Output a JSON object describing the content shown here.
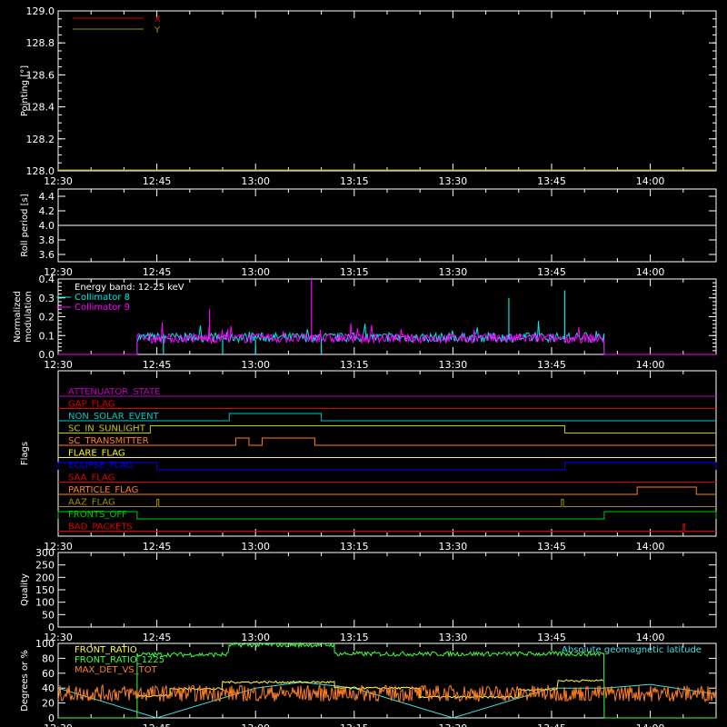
{
  "chart_data": [
    {
      "type": "line",
      "panel": "pointing",
      "ylabel": "Pointing [°]",
      "ylim": [
        128.0,
        129.0
      ],
      "yticks": [
        "128.0",
        "128.2",
        "128.4",
        "128.6",
        "128.8",
        "129.0"
      ],
      "xticks": [
        "12:30",
        "12:45",
        "13:00",
        "13:15",
        "13:30",
        "13:45",
        "14:00"
      ],
      "xlim": [
        "12:30",
        "14:10"
      ],
      "legend": "top-left",
      "series": [
        {
          "name": "X",
          "color": "#e00000",
          "values": []
        },
        {
          "name": "Y",
          "color": "#a09000",
          "values": []
        }
      ]
    },
    {
      "type": "line",
      "panel": "roll-period",
      "ylabel": "Roll period [s]",
      "ylim": [
        3.5,
        4.5
      ],
      "yticks": [
        "3.6",
        "3.8",
        "4.0",
        "4.2",
        "4.4"
      ],
      "xticks": [
        "12:30",
        "12:45",
        "13:00",
        "13:15",
        "13:30",
        "13:45",
        "14:00"
      ],
      "series": [
        {
          "color": "#ffffff",
          "x": [
            "12:30",
            "14:10"
          ],
          "values": [
            4.0,
            4.0
          ]
        }
      ]
    },
    {
      "type": "line",
      "panel": "modulation",
      "ylabel": "Normalized modulation",
      "ylim": [
        0.0,
        0.4
      ],
      "yticks": [
        "0.0",
        "0.1",
        "0.2",
        "0.3",
        "0.4"
      ],
      "xticks": [
        "12:30",
        "12:45",
        "13:00",
        "13:15",
        "13:30",
        "13:45",
        "14:00"
      ],
      "annotation": "Energy band: 12-25 keV",
      "legend": "top-left",
      "series": [
        {
          "name": "Collimator 8",
          "color": "#00e8e8",
          "x_start": "12:42",
          "x_end": "13:53",
          "baseline": 0.09
        },
        {
          "name": "Collimator 9",
          "color": "#ff00ff",
          "x_start": "12:42",
          "x_end": "13:53",
          "baseline": 0.085
        }
      ],
      "spikes": [
        {
          "series": "Collimator 9",
          "t": "13:08.5",
          "v": 0.4
        },
        {
          "series": "Collimator 8",
          "t": "13:38.5",
          "v": 0.3
        },
        {
          "series": "Collimator 8",
          "t": "13:47",
          "v": 0.34
        },
        {
          "series": "Collimator 9",
          "t": "12:53",
          "v": 0.24
        }
      ]
    },
    {
      "type": "line",
      "panel": "flags",
      "ylabel": "Flags",
      "xticks": [
        "12:30",
        "12:45",
        "13:00",
        "13:15",
        "13:30",
        "13:45",
        "14:00"
      ],
      "flags": [
        {
          "name": "ATTENUATOR_STATE",
          "color": "#c000c0",
          "steps": []
        },
        {
          "name": "GAP_FLAG",
          "color": "#e00000",
          "steps": []
        },
        {
          "name": "NON_SOLAR_EVENT",
          "color": "#00c8c8",
          "steps": [
            [
              "12:56",
              "13:10"
            ]
          ]
        },
        {
          "name": "SC_IN_SUNLIGHT",
          "color": "#c8c800",
          "steps": [
            [
              "12:44",
              "13:47"
            ]
          ]
        },
        {
          "name": "SC_TRANSMITTER",
          "color": "#ff8020",
          "steps": [
            [
              "12:57",
              "12:59"
            ],
            [
              "13:01",
              "13:09"
            ]
          ]
        },
        {
          "name": "FLARE_FLAG",
          "color": "#ffff00",
          "steps": []
        },
        {
          "name": "ECLIPSE_FLAG",
          "color": "#0000ff",
          "steps": [
            [
              "12:30",
              "12:45"
            ],
            [
              "13:47",
              "14:10"
            ]
          ]
        },
        {
          "name": "SAA_FLAG",
          "color": "#e00000",
          "steps": []
        },
        {
          "name": "PARTICLE_FLAG",
          "color": "#ff8020",
          "steps": [
            [
              "13:58",
              "14:07"
            ]
          ]
        },
        {
          "name": "AAZ_FLAG",
          "color": "#a09000",
          "steps": [
            [
              "12:45",
              "12:45.3"
            ],
            [
              "13:46.5",
              "13:46.8"
            ]
          ]
        },
        {
          "name": "FRONTS_OFF",
          "color": "#00d000",
          "steps": [
            [
              "12:30",
              "12:42"
            ],
            [
              "13:53",
              "14:10"
            ]
          ]
        },
        {
          "name": "BAD_PACKETS",
          "color": "#e00000",
          "steps": [
            [
              "14:05",
              "14:05.2"
            ]
          ]
        }
      ]
    },
    {
      "type": "line",
      "panel": "quality",
      "ylabel": "Quality",
      "ylim": [
        0,
        300
      ],
      "yticks": [
        "0",
        "50",
        "100",
        "150",
        "200",
        "250",
        "300"
      ],
      "xticks": [
        "12:30",
        "12:45",
        "13:00",
        "13:15",
        "13:30",
        "13:45",
        "14:00"
      ],
      "series": []
    },
    {
      "type": "line",
      "panel": "ratios",
      "ylabel": "Degrees or %",
      "ylim": [
        0,
        100
      ],
      "yticks": [
        "0",
        "20",
        "40",
        "60",
        "80",
        "100"
      ],
      "xticks": [
        "12:30",
        "12:45",
        "13:00",
        "13:15",
        "13:30",
        "13:45",
        "14:00"
      ],
      "legend": "top-left",
      "series": [
        {
          "name": "FRONT_RATIO",
          "color": "#ffff40"
        },
        {
          "name": "FRONT_RATIO_1225",
          "color": "#40ff40"
        },
        {
          "name": "MAX_DET_VS_TOT",
          "color": "#ff8020"
        },
        {
          "name": "Absolute geomagnetic latitude",
          "color": "#40e0e0"
        }
      ],
      "front_ratio_segments": [
        {
          "from": "12:42",
          "to": "12:47",
          "v": 30
        },
        {
          "from": "12:47",
          "to": "12:55",
          "v": 39
        },
        {
          "from": "12:55",
          "to": "13:12",
          "v": 48
        },
        {
          "from": "13:12",
          "to": "13:25",
          "v": 40
        },
        {
          "from": "13:25",
          "to": "13:40",
          "v": 28
        },
        {
          "from": "13:40",
          "to": "13:46",
          "v": 38
        },
        {
          "from": "13:46",
          "to": "13:53",
          "v": 50
        }
      ],
      "front_ratio_1225_segments": [
        {
          "from": "12:42",
          "to": "12:56",
          "v": 85
        },
        {
          "from": "12:56",
          "to": "13:12",
          "v": 98
        },
        {
          "from": "13:12",
          "to": "13:53",
          "v": 86
        }
      ],
      "geomag_points": [
        [
          "12:30",
          "40"
        ],
        [
          "12:45",
          "0"
        ],
        [
          "13:00",
          "40"
        ],
        [
          "13:07",
          "48"
        ],
        [
          "13:15",
          "40"
        ],
        [
          "13:30",
          "0"
        ],
        [
          "13:45",
          "40"
        ],
        [
          "13:53",
          "40"
        ],
        [
          "14:00",
          "45"
        ],
        [
          "14:10",
          "32"
        ]
      ]
    }
  ]
}
